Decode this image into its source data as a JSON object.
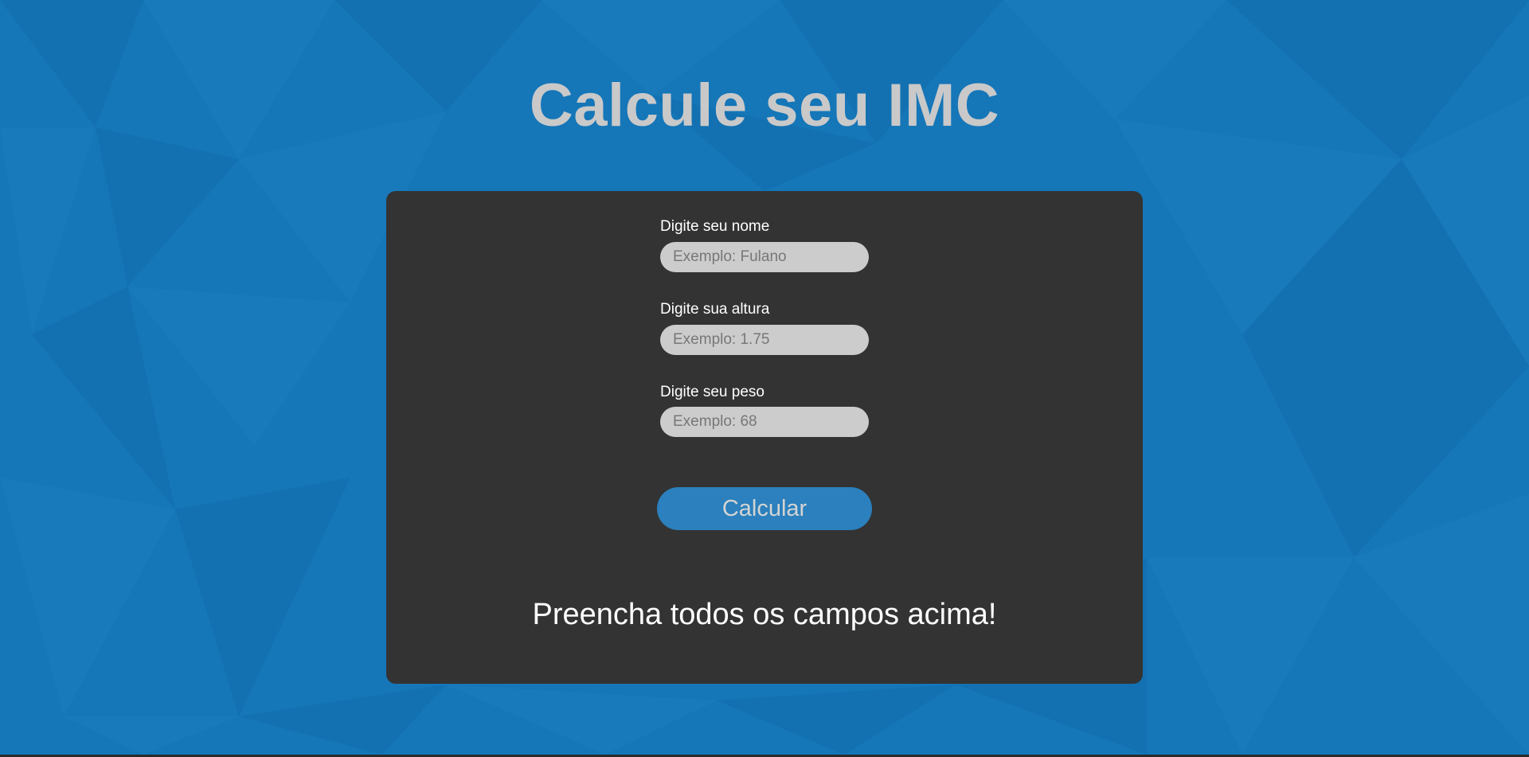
{
  "page": {
    "title": "Calcule seu IMC",
    "background_color": "#1576b8",
    "card_color": "#333333",
    "accent_color": "#2b80bd"
  },
  "form": {
    "name": {
      "label": "Digite seu nome",
      "value": "",
      "placeholder": "Exemplo: Fulano"
    },
    "height": {
      "label": "Digite sua altura",
      "value": "",
      "placeholder": "Exemplo: 1.75"
    },
    "weight": {
      "label": "Digite seu peso",
      "value": "",
      "placeholder": "Exemplo: 68"
    },
    "submit_label": "Calcular"
  },
  "result": {
    "message": "Preencha todos os campos acima!"
  }
}
